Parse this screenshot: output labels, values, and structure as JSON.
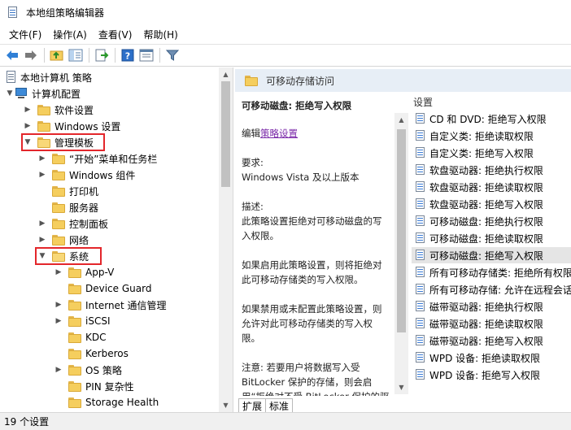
{
  "window": {
    "title": "本地组策略编辑器"
  },
  "menu": [
    "文件(F)",
    "操作(A)",
    "查看(V)",
    "帮助(H)"
  ],
  "toolbar": {
    "icons": [
      "back-arrow-icon",
      "forward-arrow-icon",
      "up-folder-icon",
      "show-hide-tree-icon",
      "export-list-icon",
      "help-icon",
      "properties-icon",
      "filter-icon"
    ]
  },
  "tree": {
    "root": "本地计算机 策略",
    "computer_config": "计算机配置",
    "items": [
      {
        "label": "软件设置"
      },
      {
        "label": "Windows 设置"
      },
      {
        "label": "管理模板"
      },
      {
        "label": "“开始”菜单和任务栏"
      },
      {
        "label": "Windows 组件"
      },
      {
        "label": "打印机"
      },
      {
        "label": "服务器"
      },
      {
        "label": "控制面板"
      },
      {
        "label": "网络"
      },
      {
        "label": "系统"
      },
      {
        "label": "App-V"
      },
      {
        "label": "Device Guard"
      },
      {
        "label": "Internet 通信管理"
      },
      {
        "label": "iSCSI"
      },
      {
        "label": "KDC"
      },
      {
        "label": "Kerberos"
      },
      {
        "label": "OS 策略"
      },
      {
        "label": "PIN 复杂性"
      },
      {
        "label": "Storage Health"
      }
    ]
  },
  "right": {
    "header": "可移动存储访问",
    "description": {
      "title": "可移动磁盘: 拒绝写入权限",
      "edit_prefix": "编辑",
      "edit_link": "策略设置",
      "requirement_label": "要求:",
      "requirement_value": "Windows Vista 及以上版本",
      "desc_label": "描述:",
      "desc_text": "此策略设置拒绝对可移动磁盘的写入权限。",
      "enabled_text": "如果启用此策略设置，则将拒绝对此可移动存储类的写入权限。",
      "disabled_text": "如果禁用或未配置此策略设置，则允许对此可移动存储类的写入权限。",
      "note_text": "注意: 若要用户将数据写入受 BitLocker 保护的存储，则会启用“拒绝对不受 BitLocker 保护的驱动器的写入权限”策略设置，该设置"
    },
    "settings_header": "设置",
    "settings": [
      "CD 和 DVD: 拒绝写入权限",
      "自定义类: 拒绝读取权限",
      "自定义类: 拒绝写入权限",
      "软盘驱动器: 拒绝执行权限",
      "软盘驱动器: 拒绝读取权限",
      "软盘驱动器: 拒绝写入权限",
      "可移动磁盘: 拒绝执行权限",
      "可移动磁盘: 拒绝读取权限",
      "可移动磁盘: 拒绝写入权限",
      "所有可移动存储类: 拒绝所有权限",
      "所有可移动存储: 允许在远程会话中直接访问",
      "磁带驱动器: 拒绝执行权限",
      "磁带驱动器: 拒绝读取权限",
      "磁带驱动器: 拒绝写入权限",
      "WPD 设备: 拒绝读取权限",
      "WPD 设备: 拒绝写入权限"
    ],
    "selected_setting": "可移动磁盘: 拒绝写入权限",
    "tabs": [
      "扩展",
      "标准"
    ]
  },
  "status": {
    "text": "19 个设置"
  },
  "colors": {
    "highlight_box": "#e3262b",
    "folder": "#f5ce5e",
    "header_bg": "#e7eef6",
    "selected_row": "#e5e5e5"
  }
}
